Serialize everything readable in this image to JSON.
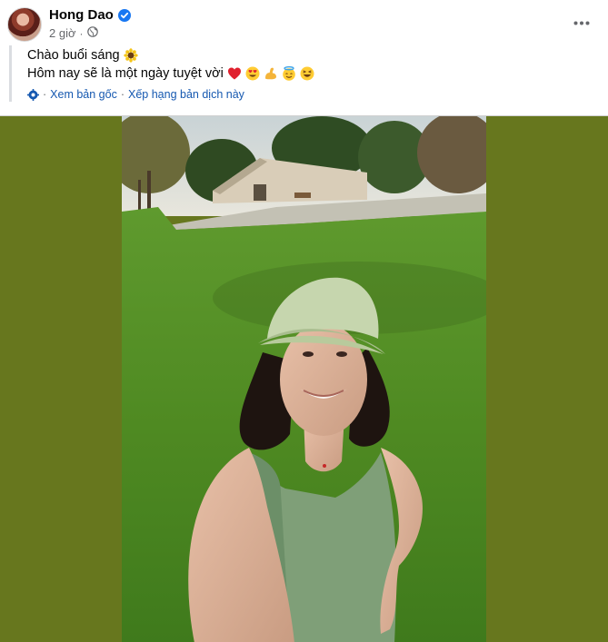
{
  "post": {
    "author": "Hong Dao",
    "time": "2 giờ",
    "lines": [
      "Chào buổi sáng",
      "Hôm nay sẽ là một ngày tuyệt vời"
    ],
    "translate": {
      "original_link": "Xem bản gốc",
      "separator": "·",
      "rate_link": "Xếp hạng bản dịch này"
    }
  },
  "icons": {
    "verified": "verified-badge-icon",
    "privacy": "globe-icon",
    "more": "more-options-icon",
    "translate": "translate-gear-icon",
    "line1_emoji": "sunflower-emoji",
    "line2_emojis": [
      "red-heart-emoji",
      "heart-eyes-emoji",
      "flexed-biceps-emoji",
      "smiling-halo-emoji",
      "laughing-emoji"
    ]
  },
  "colors": {
    "link": "#1558b0",
    "verified": "#1877f2",
    "media_background": "#67771e",
    "meta": "#65676b"
  }
}
